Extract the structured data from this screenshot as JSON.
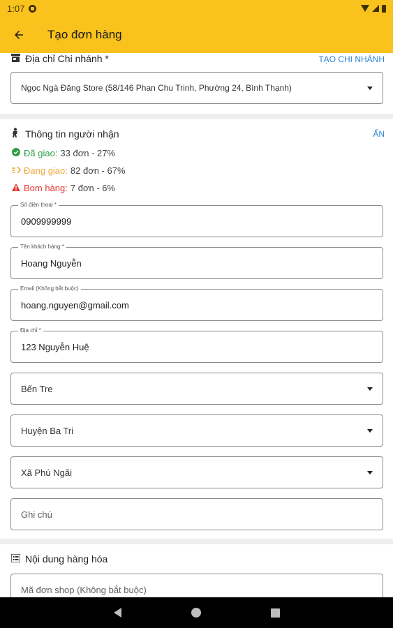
{
  "status_bar": {
    "time": "1:07"
  },
  "app_bar": {
    "back_icon": "arrow-left-icon",
    "title": "Tạo đơn hàng"
  },
  "branch_section": {
    "title": "Địa chỉ Chi nhánh *",
    "action": "TẠO CHI NHÁNH",
    "selected_branch": "Ngọc Ngà Đăng Store (58/146 Phan Chu Trinh, Phường 24, Bình Thạnh)"
  },
  "receiver_section": {
    "title": "Thông tin người nhận",
    "action": "ẨN",
    "stats": [
      {
        "icon": "check-circle-icon",
        "label": "Đã giao:",
        "value": "33 đơn - 27%",
        "color": "#2e9e47"
      },
      {
        "icon": "delivery-icon",
        "label": "Đang giao:",
        "value": "82 đơn - 67%",
        "color": "#f0a83a"
      },
      {
        "icon": "warning-icon",
        "label": "Bom hàng:",
        "value": "7 đơn - 6%",
        "color": "#e53935"
      }
    ],
    "fields": {
      "phone": {
        "label": "Số điện thoại *",
        "value": "0909999999"
      },
      "name": {
        "label": "Tên khách hàng *",
        "value": "Hoang Nguyễn"
      },
      "email": {
        "label": "Email (Không bắt buộc)",
        "value": "hoang.nguyen@gmail.com"
      },
      "address": {
        "label": "Địa chỉ *",
        "value": "123 Nguyễn Huệ"
      },
      "province": "Bến Tre",
      "district": "Huyện Ba Tri",
      "ward": "Xã Phú Ngãi",
      "note_placeholder": "Ghi chú"
    }
  },
  "goods_section": {
    "title": "Nội dung hàng hóa",
    "shop_code_placeholder": "Mã đơn shop (Không bắt buộc)"
  },
  "colors": {
    "accent": "#f9c21c",
    "link": "#2f86d4"
  }
}
